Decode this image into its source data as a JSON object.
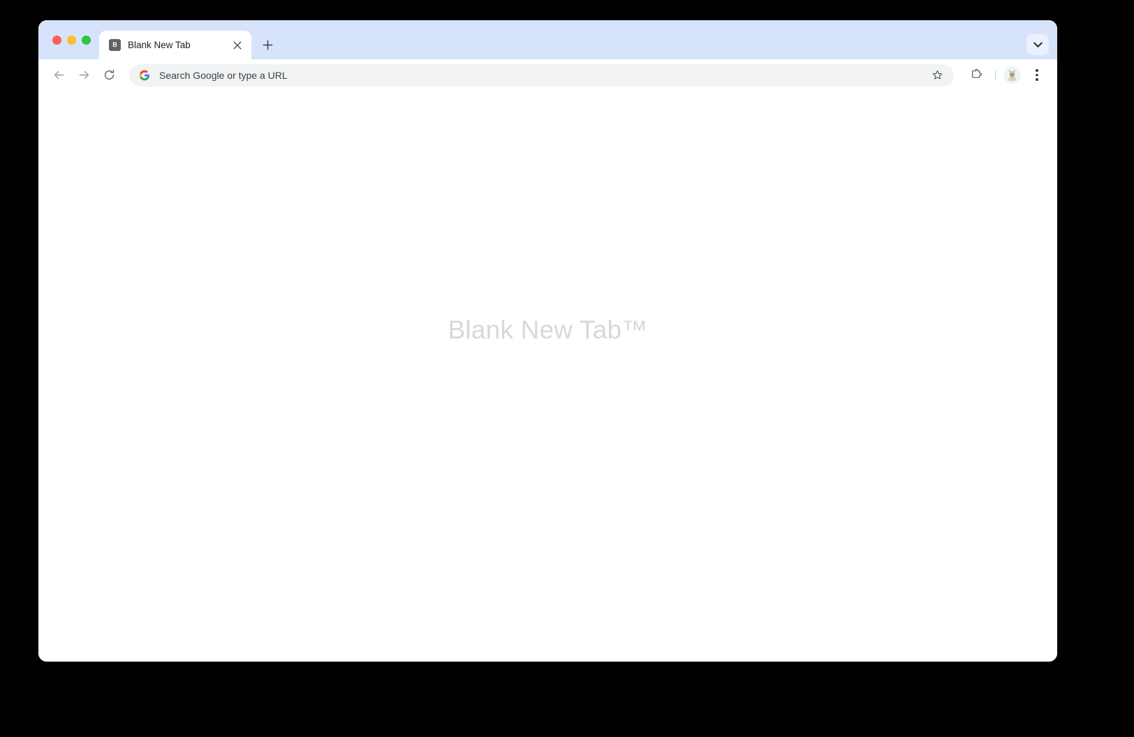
{
  "window": {
    "traffic_lights": [
      {
        "name": "close",
        "color": "#ff5f57"
      },
      {
        "name": "minimize",
        "color": "#febc2e"
      },
      {
        "name": "maximize",
        "color": "#28c840"
      }
    ],
    "tabstrip_color": "#d7e3fb",
    "chrome_color": "#ffffff"
  },
  "tabstrip": {
    "tabs": [
      {
        "title": "Blank New Tab",
        "favicon_letter": "B",
        "favicon_color": "#5f6368",
        "active": true,
        "close_icon": "close-icon"
      }
    ],
    "new_tab_label": "+",
    "tab_search_icon": "chevron-down-icon"
  },
  "toolbar": {
    "back_icon": "arrow-left-icon",
    "forward_icon": "arrow-right-icon",
    "reload_icon": "reload-icon",
    "omnibox": {
      "icon": "google-g-icon",
      "value": "",
      "placeholder": "Search Google or type a URL"
    },
    "bookmark_icon": "star-icon",
    "extensions_icon": "puzzle-piece-icon",
    "profile_icon": "avatar-dog-icon",
    "menu_icon": "three-dot-menu-icon",
    "omnibox_bg": "#f1f3f4"
  },
  "page": {
    "heading": "Blank New Tab™",
    "heading_color": "#d8d8d8",
    "background": "#ffffff"
  }
}
